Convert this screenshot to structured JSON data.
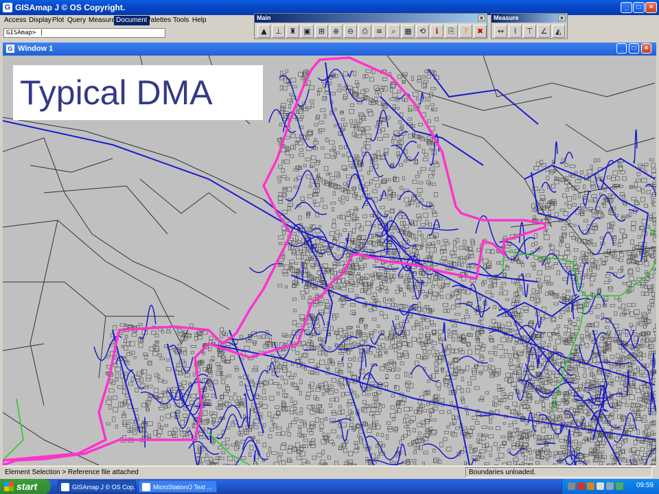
{
  "window": {
    "title": "GISAmap J © OS Copyright.",
    "icon": "gisamap-app-icon"
  },
  "menu": [
    {
      "label": "Access"
    },
    {
      "label": "Display"
    },
    {
      "label": "Plot"
    },
    {
      "label": "Query"
    },
    {
      "label": "Measure"
    },
    {
      "label": "Document",
      "active": true
    },
    {
      "label": "Palettes"
    },
    {
      "label": "Tools"
    },
    {
      "label": "Help"
    }
  ],
  "command_line": {
    "value": "GISAmap> |"
  },
  "palettes": {
    "main": {
      "title": "Main",
      "tools": [
        "landscape-icon",
        "scale-icon",
        "stamp-icon",
        "image-icon",
        "fit-view-icon",
        "zoom-in-icon",
        "zoom-out-icon",
        "print-icon",
        "layers-icon",
        "find-icon",
        "grid-icon",
        "sync-icon",
        "info-icon",
        "reference-icon",
        "help-icon",
        "cancel-icon"
      ]
    },
    "measure": {
      "title": "Measure",
      "tools": [
        "distance-icon",
        "path-icon",
        "height-icon",
        "angle-icon",
        "area-icon"
      ]
    }
  },
  "map_window": {
    "title": "Window 1",
    "overlay_label": "Typical DMA"
  },
  "status": {
    "left": "Element Selection > Reference file attached",
    "right": "Boundaries unloaded."
  },
  "taskbar": {
    "start_label": "start",
    "tasks": [
      {
        "label": "GISAmap J © OS Cop...",
        "active": true
      },
      {
        "label": "MicroStation/J Text ...",
        "active": false
      }
    ],
    "clock": "09:59"
  },
  "colors": {
    "dma_boundary": "#ff33cc",
    "water_mains": "#1a1acc",
    "other_boundary": "#22cc22",
    "map_background": "#c0c0c0"
  }
}
